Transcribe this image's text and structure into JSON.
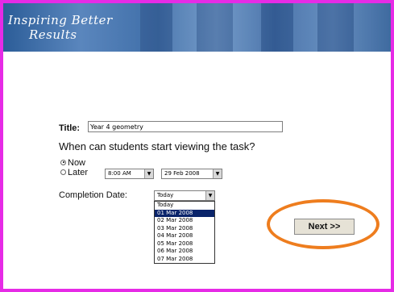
{
  "banner": {
    "logo_line1": "Inspiring Better",
    "logo_line2": "Results"
  },
  "form": {
    "title_label": "Title:",
    "title_value": "Year 4 geometry",
    "question": "When can students start viewing the task?",
    "start_options": [
      {
        "label": "Now",
        "selected": true
      },
      {
        "label": "Later",
        "selected": false
      }
    ],
    "later_time": "8:00 AM",
    "later_date": "29 Feb 2008",
    "completion_label": "Completion Date:",
    "completion_value": "Today",
    "completion_options": [
      "Today",
      "01 Mar 2008",
      "02 Mar 2008",
      "03 Mar 2008",
      "04 Mar 2008",
      "05 Mar 2008",
      "06 Mar 2008",
      "07 Mar 2008"
    ],
    "completion_highlighted": "01 Mar 2008"
  },
  "next_button": "Next >>",
  "colors": {
    "frame": "#e62be6",
    "highlight_ring": "#ee7d1e",
    "selected_option": "#0a246a"
  }
}
